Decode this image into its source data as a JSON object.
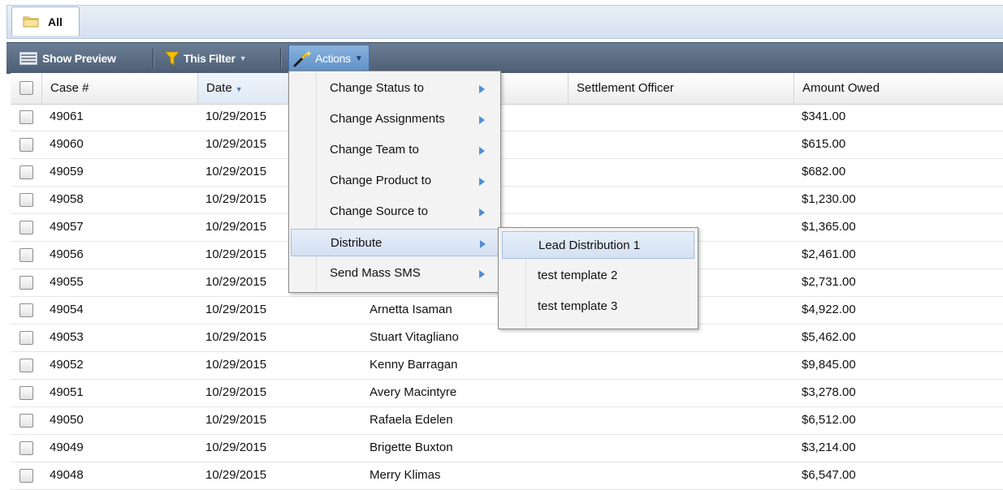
{
  "tab": {
    "label": "All",
    "icon": "folder-icon"
  },
  "toolbar": {
    "show_preview": "Show Preview",
    "this_filter": "This Filter",
    "actions": "Actions"
  },
  "columns": [
    "Case #",
    "Date",
    "Settlement Officer",
    "Amount Owed"
  ],
  "rows": [
    {
      "case": "49061",
      "date": "10/29/2015",
      "name": "",
      "amount": "$341.00"
    },
    {
      "case": "49060",
      "date": "10/29/2015",
      "name": "",
      "amount": "$615.00"
    },
    {
      "case": "49059",
      "date": "10/29/2015",
      "name": "",
      "amount": "$682.00"
    },
    {
      "case": "49058",
      "date": "10/29/2015",
      "name": "",
      "amount": "$1,230.00"
    },
    {
      "case": "49057",
      "date": "10/29/2015",
      "name": "",
      "amount": "$1,365.00"
    },
    {
      "case": "49056",
      "date": "10/29/2015",
      "name": "",
      "amount": "$2,461.00"
    },
    {
      "case": "49055",
      "date": "10/29/2015",
      "name": "",
      "amount": "$2,731.00"
    },
    {
      "case": "49054",
      "date": "10/29/2015",
      "name": "Arnetta Isaman",
      "amount": "$4,922.00"
    },
    {
      "case": "49053",
      "date": "10/29/2015",
      "name": "Stuart Vitagliano",
      "amount": "$5,462.00"
    },
    {
      "case": "49052",
      "date": "10/29/2015",
      "name": "Kenny Barragan",
      "amount": "$9,845.00"
    },
    {
      "case": "49051",
      "date": "10/29/2015",
      "name": "Avery Macintyre",
      "amount": "$3,278.00"
    },
    {
      "case": "49050",
      "date": "10/29/2015",
      "name": "Rafaela Edelen",
      "amount": "$6,512.00"
    },
    {
      "case": "49049",
      "date": "10/29/2015",
      "name": "Brigette Buxton",
      "amount": "$3,214.00"
    },
    {
      "case": "49048",
      "date": "10/29/2015",
      "name": "Merry Klimas",
      "amount": "$6,547.00"
    }
  ],
  "actions_menu": {
    "items": [
      "Change Status to",
      "Change Assignments",
      "Change Team to",
      "Change Product to",
      "Change Source to",
      "Distribute",
      "Send Mass SMS"
    ],
    "active_item": "Distribute"
  },
  "distribute_submenu": {
    "items": [
      "Lead Distribution 1",
      "test template 2",
      "test template 3"
    ],
    "active_item": "Lead Distribution 1"
  },
  "colors": {
    "toolbar": "#56677d",
    "menu_arrow": "#4f8ed6",
    "highlight": "#d4e1f3"
  }
}
